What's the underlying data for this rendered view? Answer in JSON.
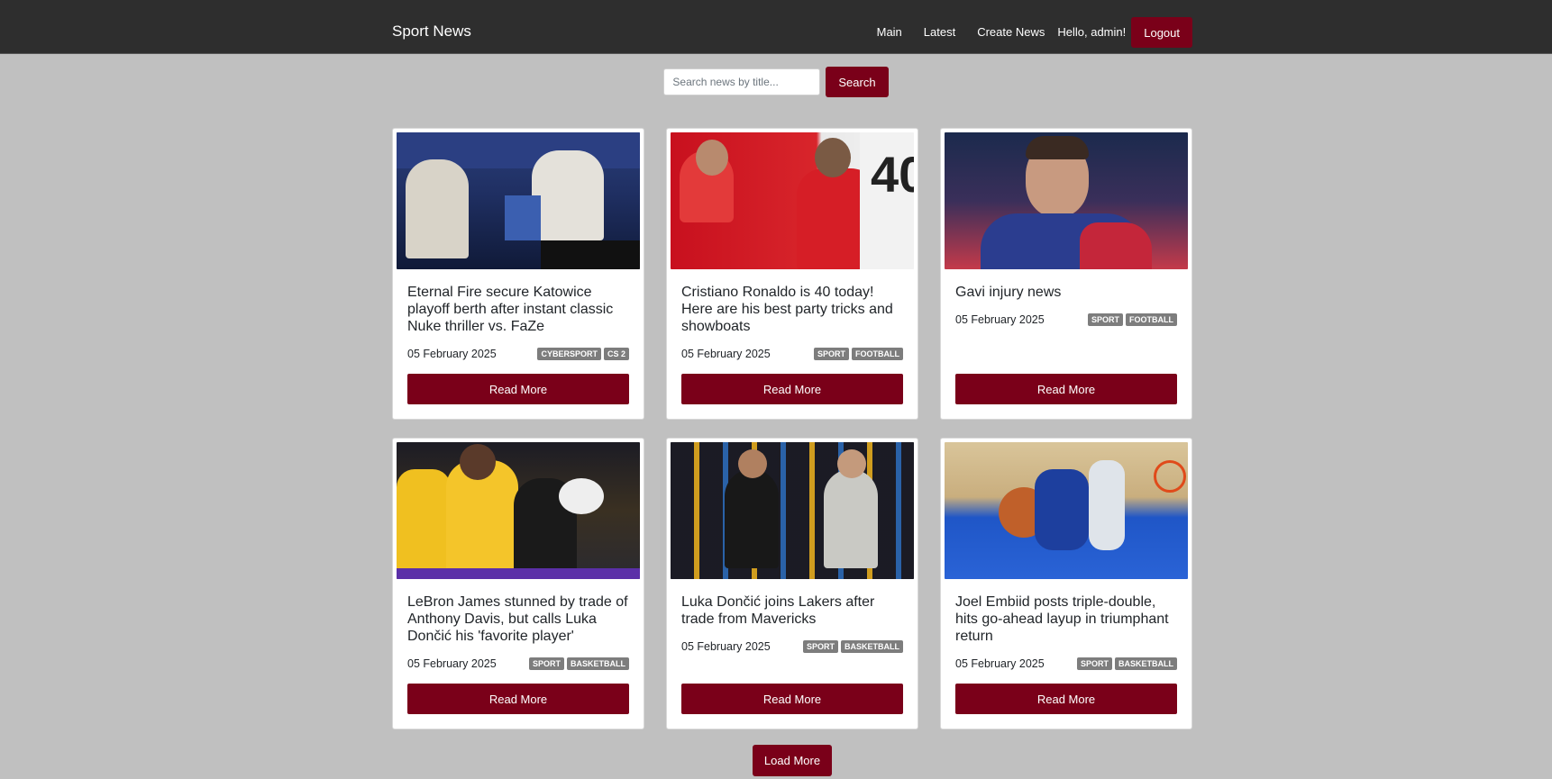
{
  "nav": {
    "brand": "Sport News",
    "links": [
      "Main",
      "Latest",
      "Create News"
    ],
    "greeting": "Hello, admin!",
    "logout_label": "Logout"
  },
  "search": {
    "placeholder": "Search news by title...",
    "button_label": "Search"
  },
  "cards": [
    {
      "title": "Eternal Fire secure Katowice playoff berth after instant classic Nuke thriller vs. FaZe",
      "date": "05 February 2025",
      "tags": [
        "CYBERSPORT",
        "CS 2"
      ],
      "button_label": "Read More"
    },
    {
      "title": "Cristiano Ronaldo is 40 today! Here are his best party tricks and showboats",
      "date": "05 February 2025",
      "tags": [
        "SPORT",
        "FOOTBALL"
      ],
      "button_label": "Read More"
    },
    {
      "title": "Gavi injury news",
      "date": "05 February 2025",
      "tags": [
        "SPORT",
        "FOOTBALL"
      ],
      "button_label": "Read More"
    },
    {
      "title": "LeBron James stunned by trade of Anthony Davis, but calls Luka Dončić his 'favorite player'",
      "date": "05 February 2025",
      "tags": [
        "SPORT",
        "BASKETBALL"
      ],
      "button_label": "Read More"
    },
    {
      "title": "Luka Dončić joins Lakers after trade from Mavericks",
      "date": "05 February 2025",
      "tags": [
        "SPORT",
        "BASKETBALL"
      ],
      "button_label": "Read More"
    },
    {
      "title": "Joel Embiid posts triple-double, hits go-ahead layup in triumphant return",
      "date": "05 February 2025",
      "tags": [
        "SPORT",
        "BASKETBALL"
      ],
      "button_label": "Read More"
    }
  ],
  "load_more_label": "Load More",
  "colors": {
    "accent": "#7a0019",
    "navbar": "#2e2e2e",
    "page_bg": "#c0c0c0",
    "tag_bg": "#7d7d7d"
  }
}
